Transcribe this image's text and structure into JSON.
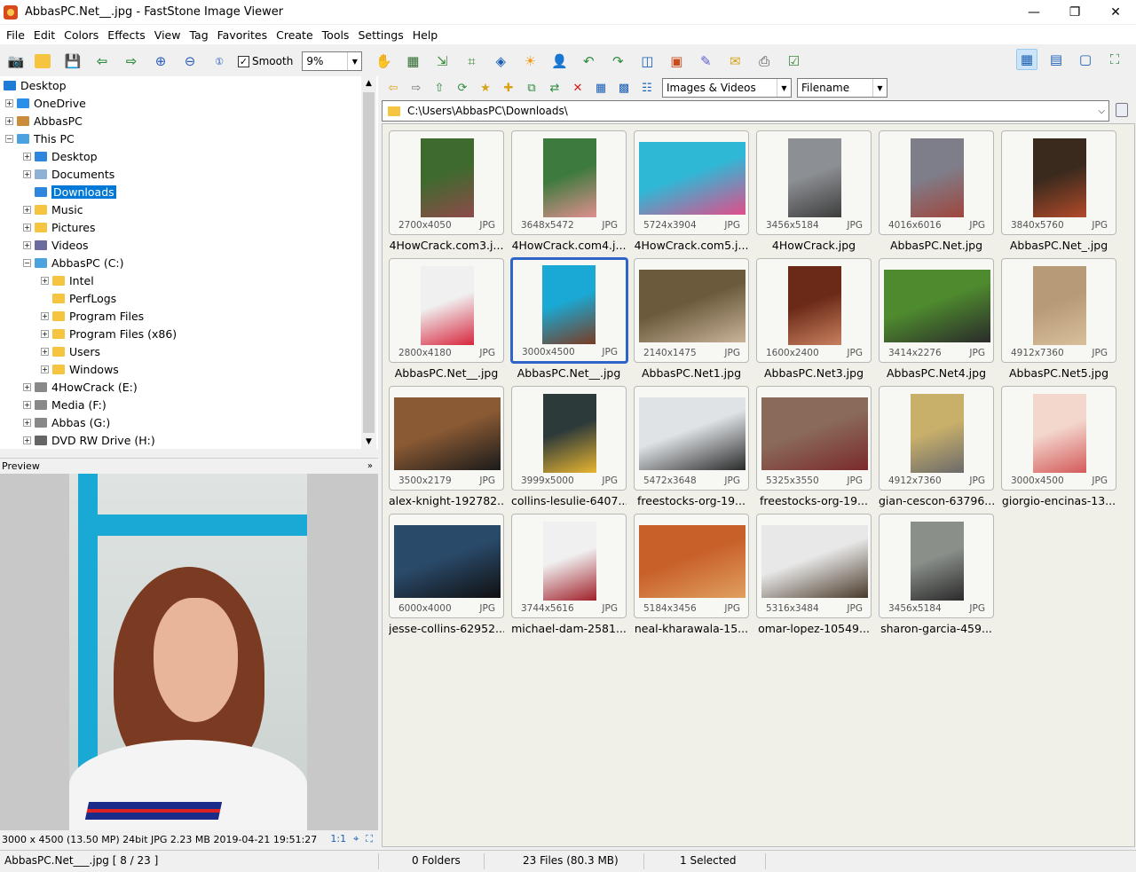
{
  "window": {
    "title": "AbbasPC.Net__.jpg  -  FastStone Image Viewer",
    "minimize": "—",
    "maximize": "❐",
    "close": "✕"
  },
  "menu": [
    "File",
    "Edit",
    "Colors",
    "Effects",
    "View",
    "Tag",
    "Favorites",
    "Create",
    "Tools",
    "Settings",
    "Help"
  ],
  "toolbar": {
    "smooth_label": "Smooth",
    "smooth_checked": "✓",
    "zoom_value": "9%"
  },
  "tree": [
    {
      "label": "Desktop",
      "level": 0,
      "exp": "",
      "color": "#1e7bd6"
    },
    {
      "label": "OneDrive",
      "level": 1,
      "exp": "+",
      "color": "#2b8ee8"
    },
    {
      "label": "AbbasPC",
      "level": 1,
      "exp": "+",
      "color": "#c98d3c"
    },
    {
      "label": "This PC",
      "level": 1,
      "exp": "−",
      "color": "#4aa3df"
    },
    {
      "label": "Desktop",
      "level": 2,
      "exp": "+",
      "color": "#2e86de"
    },
    {
      "label": "Documents",
      "level": 2,
      "exp": "+",
      "color": "#8fb1d6"
    },
    {
      "label": "Downloads",
      "level": 2,
      "exp": "",
      "color": "#2e86de",
      "selected": true
    },
    {
      "label": "Music",
      "level": 2,
      "exp": "+",
      "color": "#f5c542"
    },
    {
      "label": "Pictures",
      "level": 2,
      "exp": "+",
      "color": "#f5c542"
    },
    {
      "label": "Videos",
      "level": 2,
      "exp": "+",
      "color": "#6b6b9e"
    },
    {
      "label": "AbbasPC (C:)",
      "level": 2,
      "exp": "−",
      "color": "#4aa3df"
    },
    {
      "label": "Intel",
      "level": 3,
      "exp": "+",
      "color": "#f5c542"
    },
    {
      "label": "PerfLogs",
      "level": 3,
      "exp": "",
      "color": "#f5c542"
    },
    {
      "label": "Program Files",
      "level": 3,
      "exp": "+",
      "color": "#f5c542"
    },
    {
      "label": "Program Files (x86)",
      "level": 3,
      "exp": "+",
      "color": "#f5c542"
    },
    {
      "label": "Users",
      "level": 3,
      "exp": "+",
      "color": "#f5c542"
    },
    {
      "label": "Windows",
      "level": 3,
      "exp": "+",
      "color": "#f5c542"
    },
    {
      "label": "4HowCrack (E:)",
      "level": 2,
      "exp": "+",
      "color": "#888888"
    },
    {
      "label": "Media (F:)",
      "level": 2,
      "exp": "+",
      "color": "#888888"
    },
    {
      "label": "Abbas (G:)",
      "level": 2,
      "exp": "+",
      "color": "#888888"
    },
    {
      "label": "DVD RW Drive (H:)",
      "level": 2,
      "exp": "+",
      "color": "#666666"
    }
  ],
  "preview": {
    "header": "Preview",
    "info": "3000 x 4500 (13.50 MP)  24bit  JPG  2.23 MB  2019-04-21 19:51:27",
    "ratio": "1:1"
  },
  "filters": {
    "type": "Images & Videos",
    "sort": "Filename"
  },
  "path": "C:\\Users\\AbbasPC\\Downloads\\",
  "thumbs": [
    {
      "dims": "2700x4050",
      "ext": "JPG",
      "name": "4HowCrack.com3.j...",
      "portrait": true,
      "c1": "#3f6a2e",
      "c2": "#8e4a4a"
    },
    {
      "dims": "3648x5472",
      "ext": "JPG",
      "name": "4HowCrack.com4.j...",
      "portrait": true,
      "c1": "#3d7a3d",
      "c2": "#e08f8f"
    },
    {
      "dims": "5724x3904",
      "ext": "JPG",
      "name": "4HowCrack.com5.j...",
      "portrait": false,
      "c1": "#2fb8d6",
      "c2": "#e24d8a"
    },
    {
      "dims": "3456x5184",
      "ext": "JPG",
      "name": "4HowCrack.jpg",
      "portrait": true,
      "c1": "#8c8f93",
      "c2": "#3d3d3d"
    },
    {
      "dims": "4016x6016",
      "ext": "JPG",
      "name": "AbbasPC.Net.jpg",
      "portrait": true,
      "c1": "#7e7e8a",
      "c2": "#a0453d"
    },
    {
      "dims": "3840x5760",
      "ext": "JPG",
      "name": "AbbasPC.Net_.jpg",
      "portrait": true,
      "c1": "#3a2a1d",
      "c2": "#b24a2a"
    },
    {
      "dims": "2800x4180",
      "ext": "JPG",
      "name": "AbbasPC.Net__.jpg",
      "portrait": true,
      "c1": "#f0f0f0",
      "c2": "#d7263d"
    },
    {
      "dims": "3000x4500",
      "ext": "JPG",
      "name": "AbbasPC.Net__.jpg",
      "portrait": true,
      "c1": "#1aa9d4",
      "c2": "#7a3b22",
      "selected": true
    },
    {
      "dims": "2140x1475",
      "ext": "JPG",
      "name": "AbbasPC.Net1.jpg",
      "portrait": false,
      "c1": "#6b5a3c",
      "c2": "#c9b49a"
    },
    {
      "dims": "1600x2400",
      "ext": "JPG",
      "name": "AbbasPC.Net3.jpg",
      "portrait": true,
      "c1": "#6b2a17",
      "c2": "#c98060"
    },
    {
      "dims": "3414x2276",
      "ext": "JPG",
      "name": "AbbasPC.Net4.jpg",
      "portrait": false,
      "c1": "#4e8a2e",
      "c2": "#2a2a2a"
    },
    {
      "dims": "4912x7360",
      "ext": "JPG",
      "name": "AbbasPC.Net5.jpg",
      "portrait": true,
      "c1": "#b79a76",
      "c2": "#d8c09a"
    },
    {
      "dims": "3500x2179",
      "ext": "JPG",
      "name": "alex-knight-192782...",
      "portrait": false,
      "c1": "#8a5a34",
      "c2": "#1a1a1a"
    },
    {
      "dims": "3999x5000",
      "ext": "JPG",
      "name": "collins-lesulie-6407...",
      "portrait": true,
      "c1": "#2d3a3a",
      "c2": "#e8b530"
    },
    {
      "dims": "5472x3648",
      "ext": "JPG",
      "name": "freestocks-org-19...",
      "portrait": false,
      "c1": "#dfe3e6",
      "c2": "#2a2a2a"
    },
    {
      "dims": "5325x3550",
      "ext": "JPG",
      "name": "freestocks-org-19...",
      "portrait": false,
      "c1": "#8a6a5a",
      "c2": "#7a2a2a"
    },
    {
      "dims": "4912x7360",
      "ext": "JPG",
      "name": "gian-cescon-63796...",
      "portrait": true,
      "c1": "#c9b06a",
      "c2": "#6a6a6a"
    },
    {
      "dims": "3000x4500",
      "ext": "JPG",
      "name": "giorgio-encinas-13...",
      "portrait": true,
      "c1": "#f3d6cc",
      "c2": "#d45a5a"
    },
    {
      "dims": "6000x4000",
      "ext": "JPG",
      "name": "jesse-collins-62952...",
      "portrait": false,
      "c1": "#2a4a6a",
      "c2": "#101010"
    },
    {
      "dims": "3744x5616",
      "ext": "JPG",
      "name": "michael-dam-2581...",
      "portrait": true,
      "c1": "#f0f0f0",
      "c2": "#a0202a"
    },
    {
      "dims": "5184x3456",
      "ext": "JPG",
      "name": "neal-kharawala-15...",
      "portrait": false,
      "c1": "#c8602a",
      "c2": "#e0a060"
    },
    {
      "dims": "5316x3484",
      "ext": "JPG",
      "name": "omar-lopez-10549...",
      "portrait": false,
      "c1": "#e8e8e8",
      "c2": "#4a3a2a"
    },
    {
      "dims": "3456x5184",
      "ext": "JPG",
      "name": "sharon-garcia-459...",
      "portrait": true,
      "c1": "#8a8f8a",
      "c2": "#2a2a2a"
    }
  ],
  "status": {
    "file": "AbbasPC.Net___.jpg [ 8 / 23 ]",
    "folders": "0 Folders",
    "files": "23 Files (80.3 MB)",
    "selected": "1 Selected"
  }
}
